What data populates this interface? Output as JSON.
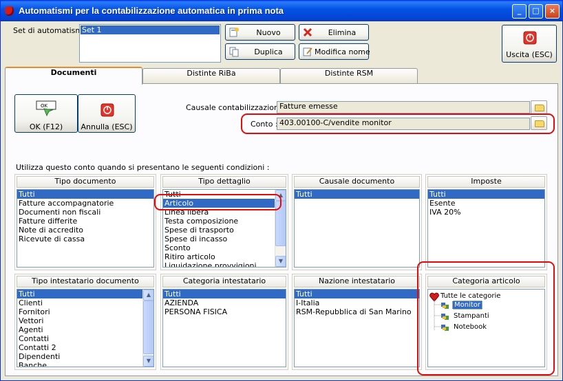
{
  "window": {
    "title": "Automatismi per la contabilizzazione automatica in prima nota",
    "buttons": {
      "minimize": "_",
      "maximize": "□",
      "close": "×"
    }
  },
  "top": {
    "set_label": "Set di automatismi :",
    "set_items": [
      "Set 1"
    ],
    "buttons": {
      "nuovo": "Nuovo",
      "elimina": "Elimina",
      "duplica": "Duplica",
      "modifica": "Modifica nome",
      "uscita": "Uscita (ESC)"
    }
  },
  "tabs": [
    "Documenti",
    "Distinte RiBa",
    "Distinte RSM"
  ],
  "panel": {
    "ok": "OK (F12)",
    "annulla": "Annulla (ESC)",
    "ok_icon_text": "OK",
    "causale_label": "Causale contabilizzazione :",
    "causale_value": "Fatture emesse",
    "conto_label": "Conto :",
    "conto_value": "403.00100-C/vendite monitor",
    "conditions_label": "Utilizza questo conto quando si presentano le seguenti condizioni :"
  },
  "lists": {
    "tipo_documento": {
      "header": "Tipo documento",
      "items": [
        "Tutti",
        "Fatture accompagnatorie",
        "Documenti non fiscali",
        "Fatture differite",
        "Note di accredito",
        "Ricevute di cassa"
      ]
    },
    "tipo_dettaglio": {
      "header": "Tipo dettaglio",
      "items": [
        "Tutti",
        "Articolo",
        "Linea libera",
        "Testa composizione",
        "Spese di trasporto",
        "Spese di incasso",
        "Sconto",
        "Ritiro articolo",
        "Liquidazione provvigioni"
      ]
    },
    "causale_documento": {
      "header": "Causale documento",
      "items": [
        "Tutti"
      ]
    },
    "imposte": {
      "header": "Imposte",
      "items": [
        "Tutti",
        "Esente",
        "IVA 20%"
      ]
    },
    "tipo_intestatario": {
      "header": "Tipo intestatario documento",
      "items": [
        "Tutti",
        "Clienti",
        "Fornitori",
        "Vettori",
        "Agenti",
        "Contatti",
        "Contatti 2",
        "Dipendenti",
        "Banche"
      ]
    },
    "categoria_intestatario": {
      "header": "Categoria intestatario",
      "items": [
        "Tutti",
        "AZIENDA",
        "PERSONA FISICA"
      ]
    },
    "nazione_intestatario": {
      "header": "Nazione intestatario",
      "items": [
        "Tutti",
        "I-Italia",
        "RSM-Repubblica di San Marino"
      ]
    },
    "categoria_articolo": {
      "header": "Categoria articolo",
      "root": "Tutte le categorie",
      "children": [
        "Monitor",
        "Stampanti",
        "Notebook"
      ]
    }
  },
  "colors": {
    "selection": "#316ac5",
    "highlight": "#e20a0a",
    "titlebar": "#0553e5"
  }
}
